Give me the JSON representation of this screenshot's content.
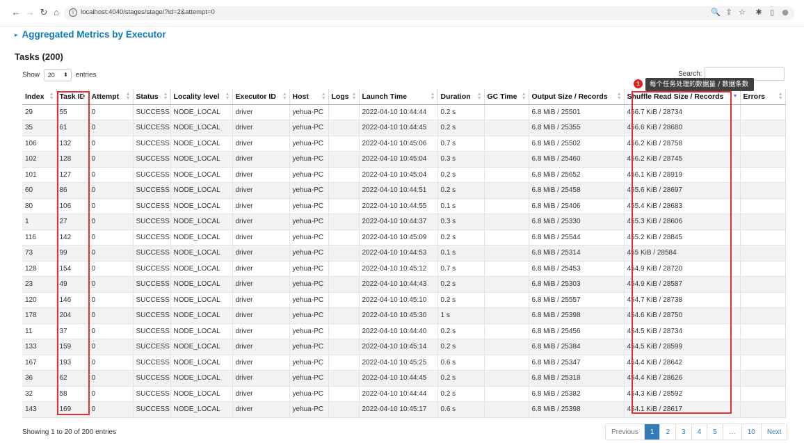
{
  "browser": {
    "url": "localhost:4040/stages/stage/?id=2&attempt=0",
    "nav": {
      "back": "←",
      "forward": "→",
      "reload": "↻",
      "home": "⌂"
    },
    "tools": [
      "🔍",
      "⇪",
      "☆",
      "✱",
      "▯",
      "●"
    ],
    "info": "i"
  },
  "page": {
    "aggregated_link": "Aggregated Metrics by Executor",
    "arrow": "▸",
    "tasks_title": "Tasks (200)",
    "show_label": "Show",
    "show_value": "20",
    "entries_label": "entries",
    "search_label": "Search:",
    "search_value": ""
  },
  "annotation": {
    "badge": "1",
    "tooltip": "每个任务处理的数据量 / 数据条数",
    "color": "#e03030"
  },
  "table": {
    "columns": [
      "Index",
      "Task ID",
      "Attempt",
      "Status",
      "Locality level",
      "Executor ID",
      "Host",
      "Logs",
      "Launch Time",
      "Duration",
      "GC Time",
      "Output Size / Records",
      "Shuffle Read Size / Records",
      "Errors"
    ],
    "rows": [
      [
        "29",
        "55",
        "0",
        "SUCCESS",
        "NODE_LOCAL",
        "driver",
        "yehua-PC",
        "",
        "2022-04-10 10:44:44",
        "0.2 s",
        "",
        "6.8 MiB / 25501",
        "456.7 KiB / 28734",
        ""
      ],
      [
        "35",
        "61",
        "0",
        "SUCCESS",
        "NODE_LOCAL",
        "driver",
        "yehua-PC",
        "",
        "2022-04-10 10:44:45",
        "0.2 s",
        "",
        "6.8 MiB / 25355",
        "456.6 KiB / 28680",
        ""
      ],
      [
        "106",
        "132",
        "0",
        "SUCCESS",
        "NODE_LOCAL",
        "driver",
        "yehua-PC",
        "",
        "2022-04-10 10:45:06",
        "0.7 s",
        "",
        "6.8 MiB / 25502",
        "456.2 KiB / 28758",
        ""
      ],
      [
        "102",
        "128",
        "0",
        "SUCCESS",
        "NODE_LOCAL",
        "driver",
        "yehua-PC",
        "",
        "2022-04-10 10:45:04",
        "0.3 s",
        "",
        "6.8 MiB / 25460",
        "456.2 KiB / 28745",
        ""
      ],
      [
        "101",
        "127",
        "0",
        "SUCCESS",
        "NODE_LOCAL",
        "driver",
        "yehua-PC",
        "",
        "2022-04-10 10:45:04",
        "0.2 s",
        "",
        "6.8 MiB / 25652",
        "456.1 KiB / 28919",
        ""
      ],
      [
        "60",
        "86",
        "0",
        "SUCCESS",
        "NODE_LOCAL",
        "driver",
        "yehua-PC",
        "",
        "2022-04-10 10:44:51",
        "0.2 s",
        "",
        "6.8 MiB / 25458",
        "455.6 KiB / 28697",
        ""
      ],
      [
        "80",
        "106",
        "0",
        "SUCCESS",
        "NODE_LOCAL",
        "driver",
        "yehua-PC",
        "",
        "2022-04-10 10:44:55",
        "0.1 s",
        "",
        "6.8 MiB / 25406",
        "455.4 KiB / 28683",
        ""
      ],
      [
        "1",
        "27",
        "0",
        "SUCCESS",
        "NODE_LOCAL",
        "driver",
        "yehua-PC",
        "",
        "2022-04-10 10:44:37",
        "0.3 s",
        "",
        "6.8 MiB / 25330",
        "455.3 KiB / 28606",
        ""
      ],
      [
        "116",
        "142",
        "0",
        "SUCCESS",
        "NODE_LOCAL",
        "driver",
        "yehua-PC",
        "",
        "2022-04-10 10:45:09",
        "0.2 s",
        "",
        "6.8 MiB / 25544",
        "455.2 KiB / 28845",
        ""
      ],
      [
        "73",
        "99",
        "0",
        "SUCCESS",
        "NODE_LOCAL",
        "driver",
        "yehua-PC",
        "",
        "2022-04-10 10:44:53",
        "0.1 s",
        "",
        "6.8 MiB / 25314",
        "455 KiB / 28584",
        ""
      ],
      [
        "128",
        "154",
        "0",
        "SUCCESS",
        "NODE_LOCAL",
        "driver",
        "yehua-PC",
        "",
        "2022-04-10 10:45:12",
        "0.7 s",
        "",
        "6.8 MiB / 25453",
        "454.9 KiB / 28720",
        ""
      ],
      [
        "23",
        "49",
        "0",
        "SUCCESS",
        "NODE_LOCAL",
        "driver",
        "yehua-PC",
        "",
        "2022-04-10 10:44:43",
        "0.2 s",
        "",
        "6.8 MiB / 25303",
        "454.9 KiB / 28587",
        ""
      ],
      [
        "120",
        "146",
        "0",
        "SUCCESS",
        "NODE_LOCAL",
        "driver",
        "yehua-PC",
        "",
        "2022-04-10 10:45:10",
        "0.2 s",
        "",
        "6.8 MiB / 25557",
        "454.7 KiB / 28738",
        ""
      ],
      [
        "178",
        "204",
        "0",
        "SUCCESS",
        "NODE_LOCAL",
        "driver",
        "yehua-PC",
        "",
        "2022-04-10 10:45:30",
        "1 s",
        "",
        "6.8 MiB / 25398",
        "454.6 KiB / 28750",
        ""
      ],
      [
        "11",
        "37",
        "0",
        "SUCCESS",
        "NODE_LOCAL",
        "driver",
        "yehua-PC",
        "",
        "2022-04-10 10:44:40",
        "0.2 s",
        "",
        "6.8 MiB / 25456",
        "454.5 KiB / 28734",
        ""
      ],
      [
        "133",
        "159",
        "0",
        "SUCCESS",
        "NODE_LOCAL",
        "driver",
        "yehua-PC",
        "",
        "2022-04-10 10:45:14",
        "0.2 s",
        "",
        "6.8 MiB / 25384",
        "454.5 KiB / 28599",
        ""
      ],
      [
        "167",
        "193",
        "0",
        "SUCCESS",
        "NODE_LOCAL",
        "driver",
        "yehua-PC",
        "",
        "2022-04-10 10:45:25",
        "0.6 s",
        "",
        "6.8 MiB / 25347",
        "454.4 KiB / 28642",
        ""
      ],
      [
        "36",
        "62",
        "0",
        "SUCCESS",
        "NODE_LOCAL",
        "driver",
        "yehua-PC",
        "",
        "2022-04-10 10:44:45",
        "0.2 s",
        "",
        "6.8 MiB / 25318",
        "454.4 KiB / 28626",
        ""
      ],
      [
        "32",
        "58",
        "0",
        "SUCCESS",
        "NODE_LOCAL",
        "driver",
        "yehua-PC",
        "",
        "2022-04-10 10:44:44",
        "0.2 s",
        "",
        "6.8 MiB / 25382",
        "454.3 KiB / 28592",
        ""
      ],
      [
        "143",
        "169",
        "0",
        "SUCCESS",
        "NODE_LOCAL",
        "driver",
        "yehua-PC",
        "",
        "2022-04-10 10:45:17",
        "0.6 s",
        "",
        "6.8 MiB / 25398",
        "454.1 KiB / 28617",
        ""
      ]
    ]
  },
  "footer": {
    "showing": "Showing 1 to 20 of 200 entries",
    "pagination": [
      "Previous",
      "1",
      "2",
      "3",
      "4",
      "5",
      "…",
      "10",
      "Next"
    ],
    "active_page": "1"
  }
}
